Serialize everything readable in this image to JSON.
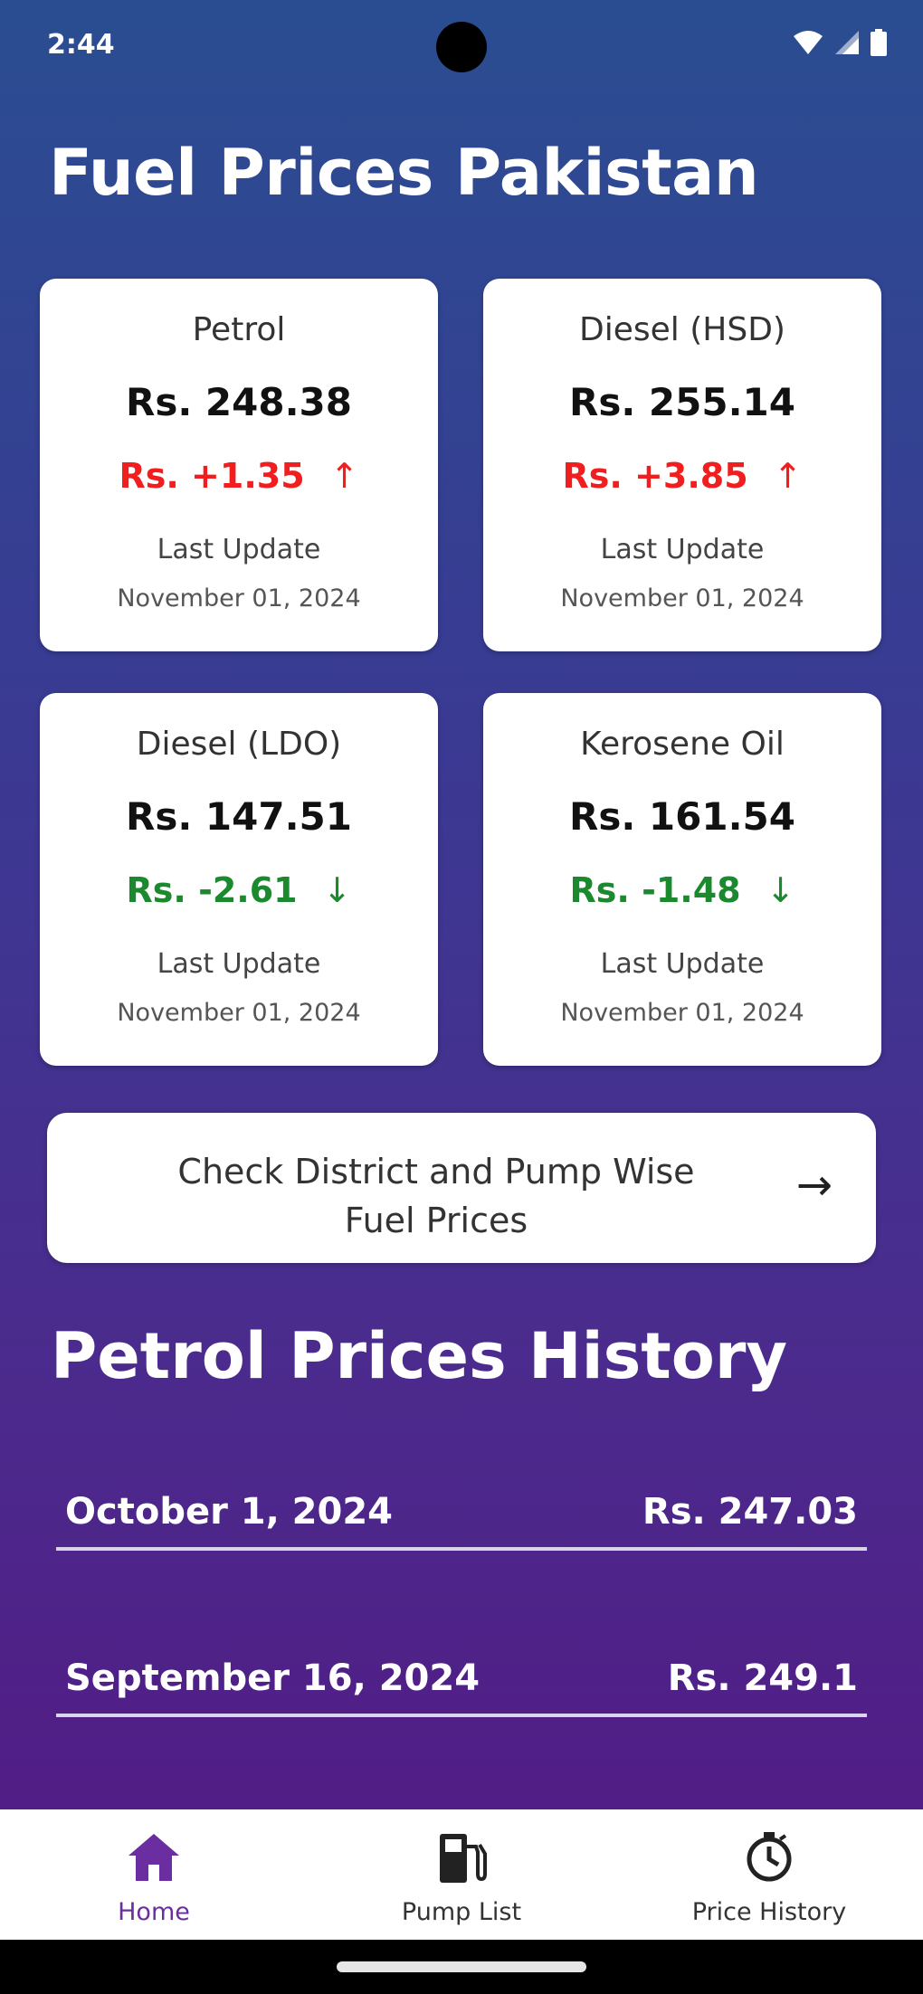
{
  "status_bar": {
    "time": "2:44"
  },
  "header": {
    "title": "Fuel Prices Pakistan"
  },
  "cards": [
    {
      "name": "Petrol",
      "price": "Rs. 248.38",
      "change": "Rs. +1.35",
      "direction": "up",
      "arrow": "↑",
      "update_label": "Last Update",
      "update_date": "November 01, 2024"
    },
    {
      "name": "Diesel (HSD)",
      "price": "Rs. 255.14",
      "change": "Rs. +3.85",
      "direction": "up",
      "arrow": "↑",
      "update_label": "Last Update",
      "update_date": "November 01, 2024"
    },
    {
      "name": "Diesel (LDO)",
      "price": "Rs. 147.51",
      "change": "Rs. -2.61",
      "direction": "down",
      "arrow": "↓",
      "update_label": "Last Update",
      "update_date": "November 01, 2024"
    },
    {
      "name": "Kerosene Oil",
      "price": "Rs. 161.54",
      "change": "Rs. -1.48",
      "direction": "down",
      "arrow": "↓",
      "update_label": "Last Update",
      "update_date": "November 01, 2024"
    }
  ],
  "district_button": {
    "label_line1": "Check District and Pump Wise",
    "label_line2": "Fuel Prices",
    "arrow": "→"
  },
  "history": {
    "title": "Petrol Prices History",
    "rows": [
      {
        "date": "October 1, 2024",
        "price": "Rs. 247.03"
      },
      {
        "date": "September 16, 2024",
        "price": "Rs. 249.1"
      }
    ]
  },
  "bottom_nav": {
    "items": [
      {
        "label": "Home",
        "icon": "home-icon",
        "active": true
      },
      {
        "label": "Pump List",
        "icon": "fuel-pump-icon",
        "active": false
      },
      {
        "label": "Price History",
        "icon": "price-history-icon",
        "active": false
      }
    ]
  },
  "colors": {
    "gradient_top": "#2a4d91",
    "gradient_bottom": "#511d86",
    "increase": "#f01e1e",
    "decrease": "#1b8a2e",
    "nav_active": "#6a2ea0"
  }
}
